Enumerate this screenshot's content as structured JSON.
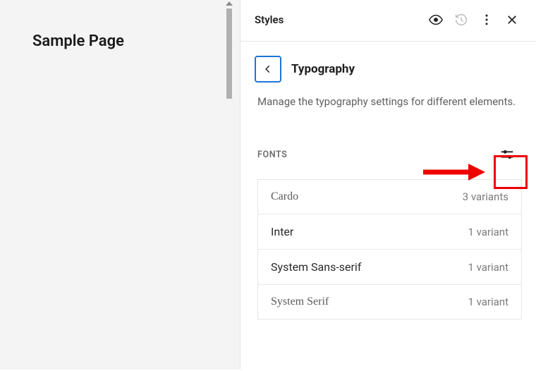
{
  "preview": {
    "page_title": "Sample Page"
  },
  "sidebar": {
    "header": {
      "title": "Styles"
    },
    "section": {
      "title": "Typography",
      "description": "Manage the typography settings for different elements."
    },
    "fonts": {
      "label": "FONTS",
      "items": [
        {
          "name": "Cardo",
          "variants": "3 variants",
          "style": "serif"
        },
        {
          "name": "Inter",
          "variants": "1 variant",
          "style": "sans"
        },
        {
          "name": "System Sans-serif",
          "variants": "1 variant",
          "style": "sans"
        },
        {
          "name": "System Serif",
          "variants": "1 variant",
          "style": "serif"
        }
      ]
    }
  }
}
